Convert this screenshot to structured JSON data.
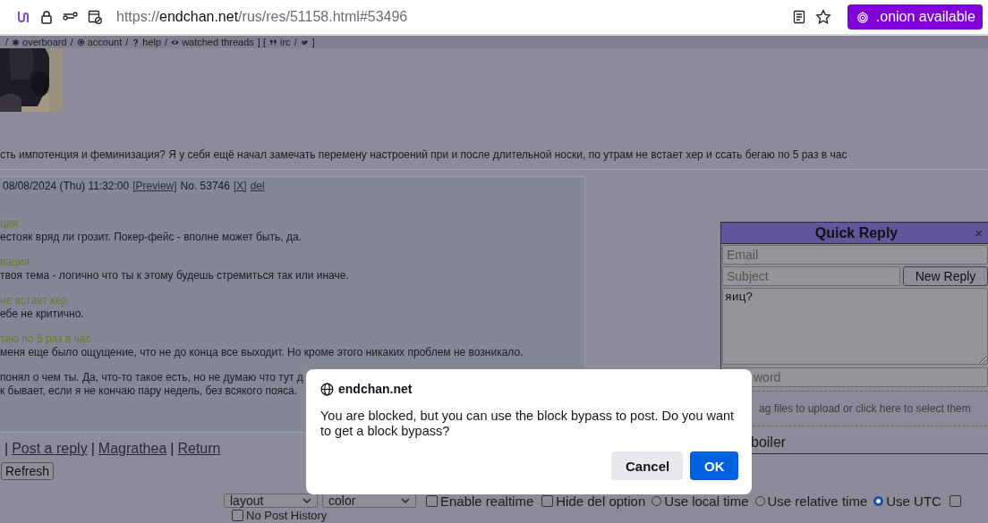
{
  "browser": {
    "url_scheme": "https://",
    "url_host": "endchan.net",
    "url_path": "/rus/res/51158.html#53496",
    "onion_badge": ".onion available"
  },
  "nav": [
    {
      "kind": "sep",
      "text": "/"
    },
    {
      "kind": "link",
      "text": "overboard"
    },
    {
      "kind": "sep",
      "text": "/"
    },
    {
      "kind": "link",
      "text": "account"
    },
    {
      "kind": "sep",
      "text": "/"
    },
    {
      "kind": "link",
      "text": "help"
    },
    {
      "kind": "sep",
      "text": "/"
    },
    {
      "kind": "link",
      "text": "watched threads"
    },
    {
      "kind": "sep",
      "text": "] ["
    },
    {
      "kind": "link",
      "text": "irc"
    },
    {
      "kind": "sep",
      "text": "/"
    },
    {
      "kind": "icon_link"
    },
    {
      "kind": "sep",
      "text": "]"
    }
  ],
  "op": {
    "text": "сть импотенция и феминизация? Я у себя ещё начал замечать перемену настроений при и после длительной носки, по утрам не встает хер и ссать бегаю по 5 раз в час"
  },
  "reply": {
    "date": "08/08/2024 (Thu) 11:32:00",
    "preview": "[Preview]",
    "number": "No. 53746",
    "delete": "[X]",
    "del": "del",
    "paragraphs": [
      {
        "lines": [
          {
            "kind": "quote",
            "text": "ция"
          },
          {
            "kind": "text",
            "text": "естояк вряд ли грозит. Покер-фейс - вполне может быть, да."
          }
        ]
      },
      {
        "lines": [
          {
            "kind": "quote",
            "text": "вация"
          },
          {
            "kind": "text",
            "text": "твоя тема - логично что ты к этому будешь стремиться так или иначе."
          }
        ]
      },
      {
        "lines": [
          {
            "kind": "quote",
            "text": "не встает хер"
          },
          {
            "kind": "text",
            "text": "ебе не критично."
          }
        ]
      },
      {
        "lines": [
          {
            "kind": "quote",
            "text": "таю по 5 раз в час"
          },
          {
            "kind": "text",
            "text": "меня еще было ощущение, что не до конца все выходит. Но кроме этого никаких проблем не возникало."
          }
        ]
      },
      {
        "lines": [
          {
            "kind": "text",
            "text": "понял о чем ты. Да, что-то такое есть, но не думаю что тут д"
          },
          {
            "kind": "text",
            "text": "к бывает, если я не кончаю пару недель, без всякого пояса."
          }
        ]
      }
    ]
  },
  "footer_links": [
    {
      "kind": "sep",
      "text": "|"
    },
    {
      "kind": "link",
      "text": "Post a reply"
    },
    {
      "kind": "sep",
      "text": "|"
    },
    {
      "kind": "link",
      "text": "Magrathea"
    },
    {
      "kind": "sep",
      "text": "|"
    },
    {
      "kind": "link",
      "text": "Return"
    }
  ],
  "refresh_button": "Refresh",
  "options": [
    {
      "kind": "select",
      "value": "layout"
    },
    {
      "kind": "select",
      "value": "color"
    },
    {
      "kind": "checkbox",
      "label": "Enable realtime",
      "checked": false
    },
    {
      "kind": "checkbox",
      "label": "Hide del option",
      "checked": false
    },
    {
      "kind": "radio",
      "label": "Use local time",
      "selected": false
    },
    {
      "kind": "radio",
      "label": "Use relative time",
      "selected": false
    },
    {
      "kind": "radio",
      "label": "Use UTC",
      "selected": true
    },
    {
      "kind": "checkbox",
      "checked": false
    },
    {
      "kind": "checkbox",
      "label": "No Post History",
      "checked": false
    }
  ],
  "quick_reply": {
    "title": "Quick Reply",
    "close": "×",
    "email_placeholder": "Email",
    "subject_placeholder": "Subject",
    "new_reply_button": "New Reply",
    "message": "яиц?",
    "password_placeholder": "word",
    "drop_zone": "ag files to upload or click here to select them",
    "spoiler_label": "boiler"
  },
  "dialog": {
    "host": "endchan.net",
    "message": "You are blocked, but you can use the block bypass to post. Do you want to get a block bypass?",
    "cancel": "Cancel",
    "ok": "OK"
  }
}
